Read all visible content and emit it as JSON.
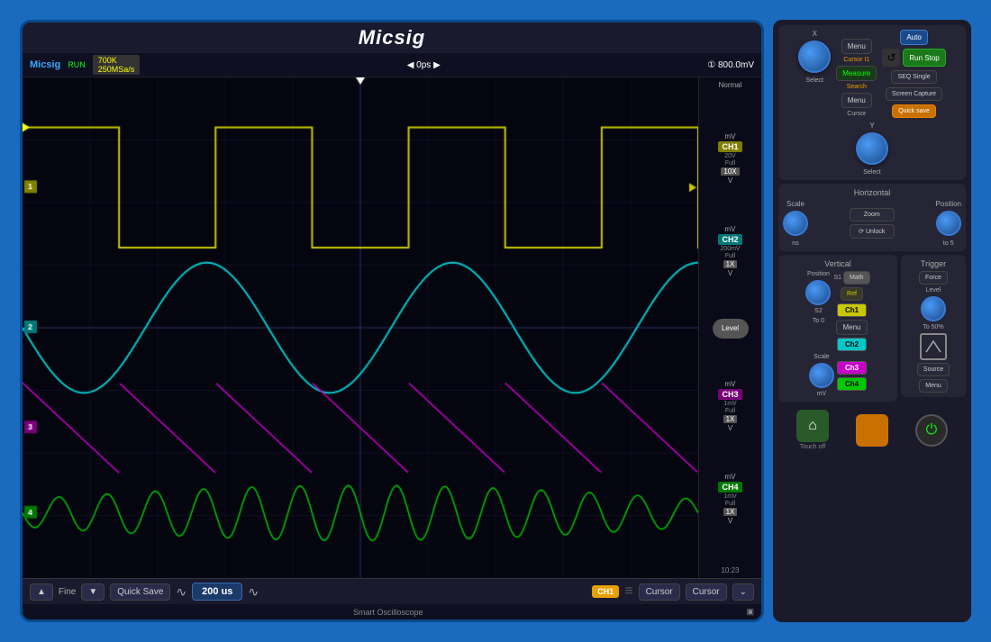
{
  "app": {
    "brand": "Micsig",
    "tagline": "Smart Oscilloscope",
    "title": "Micsig"
  },
  "screen": {
    "header": {
      "brand": "Micsig",
      "status": "RUN",
      "timebase_top": "700K",
      "sample_rate": "250MSa/s",
      "time_offset": "0ps",
      "trigger_level": "① 800.0mV",
      "normal_label": "Normal"
    },
    "channels": [
      {
        "name": "CH1",
        "color": "#c8c800",
        "voltage": "20V",
        "coupling": "Full",
        "probe": "10X",
        "unit_top": "mV",
        "unit_bot": "V",
        "indicator": "1"
      },
      {
        "name": "CH2",
        "color": "#00c8c8",
        "voltage": "200mV",
        "coupling": "Full",
        "probe": "1X",
        "unit_top": "mV",
        "unit_bot": "V",
        "indicator": "2"
      },
      {
        "name": "CH3",
        "color": "#c800c8",
        "voltage": "1mV",
        "coupling": "Full",
        "probe": "1X",
        "unit_top": "mV",
        "unit_bot": "V",
        "indicator": "3"
      },
      {
        "name": "CH4",
        "color": "#00c800",
        "voltage": "1mV",
        "coupling": "Full",
        "probe": "1X",
        "unit_top": "mV",
        "unit_bot": "V",
        "indicator": "4"
      }
    ],
    "toolbar": {
      "fine_up": "▲",
      "fine_label": "Fine",
      "fine_down": "▼",
      "quick_save": "Quick Save",
      "timebase_value": "200",
      "timebase_unit": "us",
      "ch_indicator": "CH1",
      "cursor_label1": "Cursor",
      "cursor_label2": "Cursor",
      "expand_icon": "⌄"
    },
    "footer": {
      "time": "10:23",
      "page_icon": "▣"
    }
  },
  "control_panel": {
    "section_xy": {
      "x_label": "X",
      "y_label": "Y",
      "select_label": "Select",
      "menu_btn": "Menu",
      "cursor_i1": "Cursor I1",
      "measure_btn": "Measure",
      "search_label": "Search",
      "menu_btn2": "Menu",
      "cursor_label": "Cursor",
      "auto_btn": "Auto",
      "run_stop_btn": "Run Stop",
      "seq_single_btn": "SEQ Single",
      "screen_capture_btn": "Screen Capture",
      "quick_save_btn": "Quick save"
    },
    "horizontal": {
      "title": "Horizontal",
      "scale_label": "Scale",
      "position_label": "Position",
      "zoom_btn": "Zoom",
      "unlock_btn": "⟳ Unlock",
      "ns_label": "ns",
      "to5_label": "to 5"
    },
    "vertical": {
      "title": "Vertical",
      "position_label": "Position",
      "math_btn": "Math",
      "s1_label": "S1",
      "ref_btn": "Ref",
      "s2_label": "S2",
      "to0_label": "To 0",
      "ch1_btn": "Ch1",
      "menu_btn": "Menu",
      "ch2_btn": "Ch2",
      "scale_label": "Scale",
      "ch3_btn": "Ch3",
      "mv_label": "mV",
      "ch4_btn": "Ch4"
    },
    "trigger": {
      "title": "Trigger",
      "force_btn": "Force",
      "level_label": "Level",
      "to50_label": "To 50%",
      "source_btn": "Source",
      "menu_btn": "Menu"
    },
    "nav": {
      "home_icon": "⌂",
      "touch_off": "Touch off",
      "power_icon": "⏻"
    }
  }
}
